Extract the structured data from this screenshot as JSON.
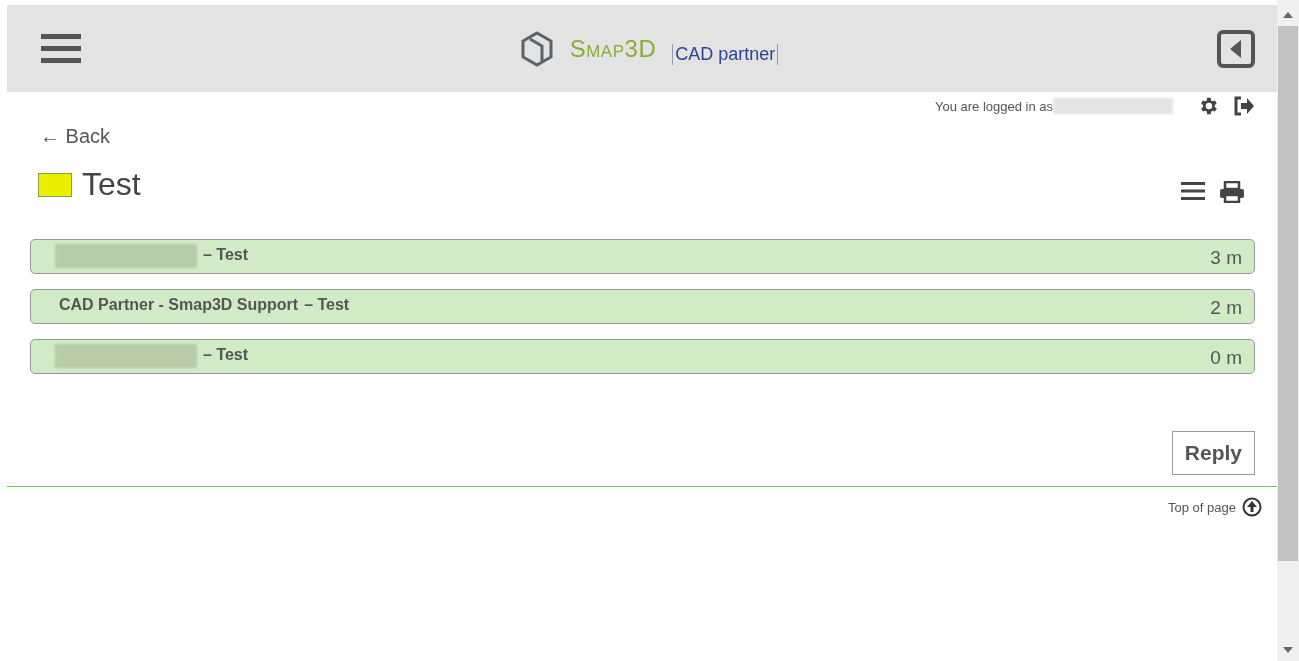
{
  "header": {
    "brand": "Smap3D",
    "partner": "CAD partner"
  },
  "user_bar": {
    "text": "You are logged in as",
    "user_redacted": true
  },
  "back": {
    "label": "← Back"
  },
  "topic": {
    "title": "Test",
    "color": "#e8f000"
  },
  "posts": [
    {
      "kind": "redacted",
      "subject": "– Test",
      "age": "3 m"
    },
    {
      "kind": "named",
      "author": "CAD Partner - Smap3D Support",
      "subject": "– Test",
      "age": "2 m"
    },
    {
      "kind": "redacted",
      "subject": "– Test",
      "age": "0 m"
    }
  ],
  "reply_button": "Reply",
  "footer": {
    "top_link": "Top of page"
  }
}
